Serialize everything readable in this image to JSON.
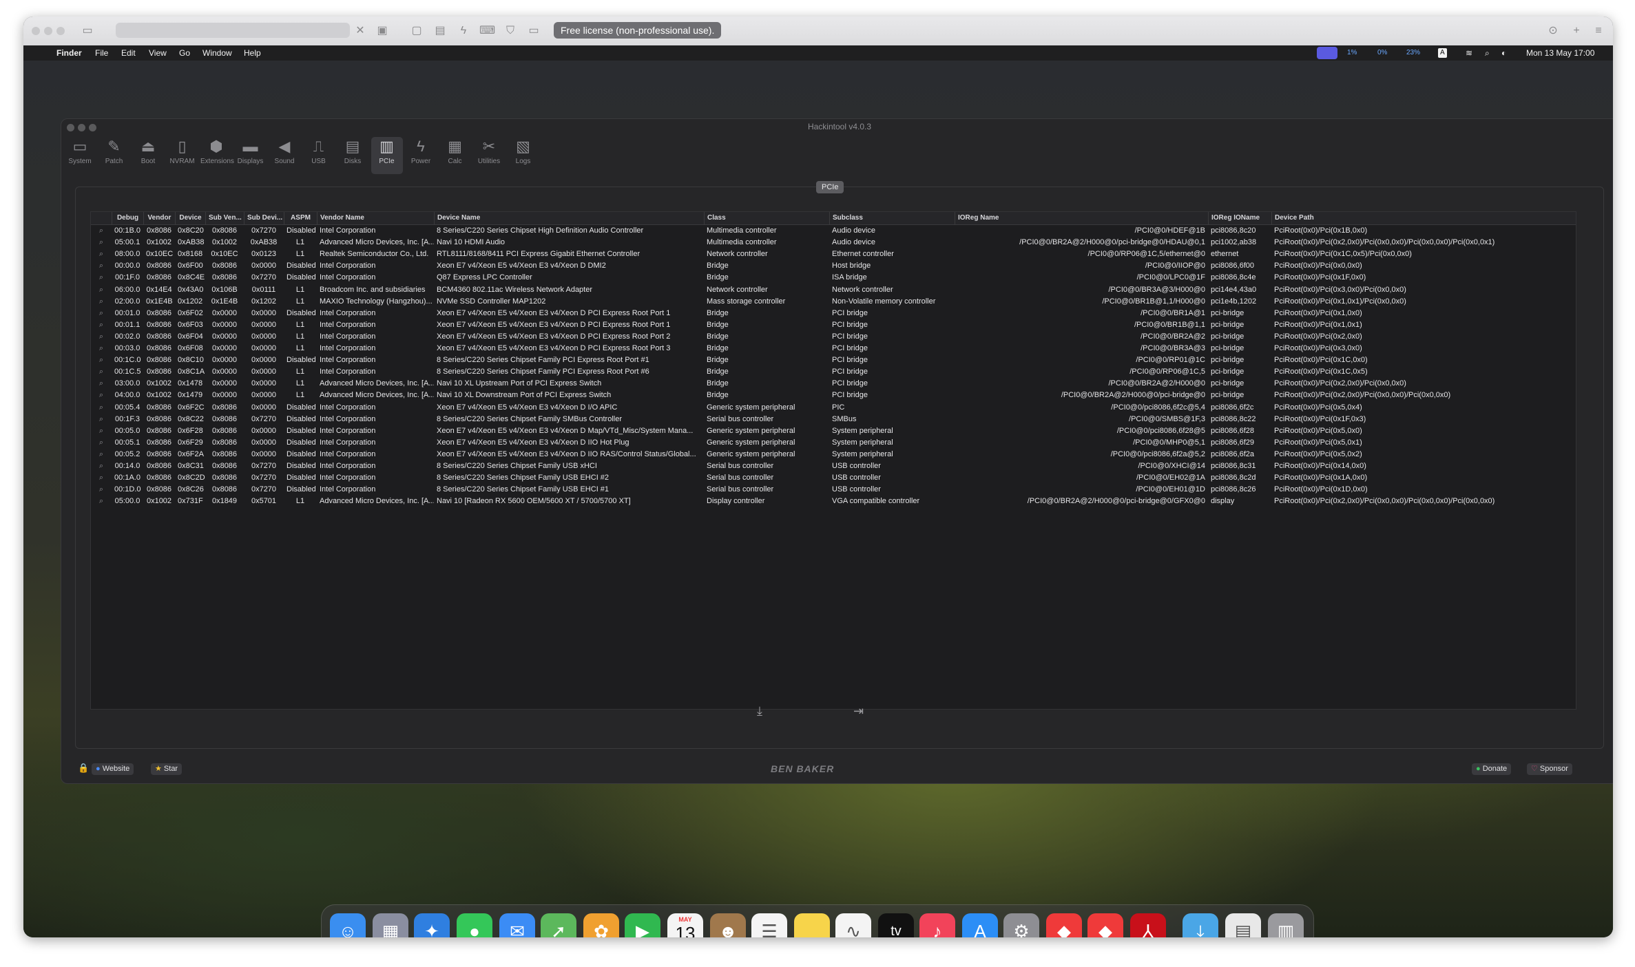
{
  "vm": {
    "license_badge": "Free license (non-professional use)."
  },
  "menubar": {
    "apple": "",
    "items": [
      "Finder",
      "File",
      "Edit",
      "View",
      "Go",
      "Window",
      "Help"
    ],
    "status": {
      "cpu": "1%",
      "gpu": "0%",
      "ram": "23%",
      "input": "A",
      "clock": "Mon 13 May  17:00"
    }
  },
  "window": {
    "title": "Hackintool v4.0.3",
    "toolbar": [
      {
        "label": "System",
        "icon": "system-icon"
      },
      {
        "label": "Patch",
        "icon": "patch-icon"
      },
      {
        "label": "Boot",
        "icon": "boot-icon"
      },
      {
        "label": "NVRAM",
        "icon": "nvram-icon"
      },
      {
        "label": "Extensions",
        "icon": "extensions-icon"
      },
      {
        "label": "Displays",
        "icon": "displays-icon"
      },
      {
        "label": "Sound",
        "icon": "sound-icon"
      },
      {
        "label": "USB",
        "icon": "usb-icon"
      },
      {
        "label": "Disks",
        "icon": "disks-icon"
      },
      {
        "label": "PCIe",
        "icon": "pcie-icon"
      },
      {
        "label": "Power",
        "icon": "power-icon"
      },
      {
        "label": "Calc",
        "icon": "calc-icon"
      },
      {
        "label": "Utilities",
        "icon": "utilities-icon"
      },
      {
        "label": "Logs",
        "icon": "logs-icon"
      }
    ],
    "active_tab": "PCIe",
    "pane_label": "PCIe",
    "columns": [
      "Debug",
      "Vendor",
      "Device",
      "Sub Ven...",
      "Sub Devi...",
      "ASPM",
      "Vendor Name",
      "Device Name",
      "Class",
      "Subclass",
      "IOReg Name",
      "IOReg IOName",
      "Device Path"
    ],
    "rows": [
      [
        "00:1B.0",
        "0x8086",
        "0x8C20",
        "0x8086",
        "0x7270",
        "Disabled",
        "Intel Corporation",
        "8 Series/C220 Series Chipset High Definition Audio Controller",
        "Multimedia controller",
        "Audio device",
        "/PCI0@0/HDEF@1B",
        "pci8086,8c20",
        "PciRoot(0x0)/Pci(0x1B,0x0)"
      ],
      [
        "05:00.1",
        "0x1002",
        "0xAB38",
        "0x1002",
        "0xAB38",
        "L1",
        "Advanced Micro Devices, Inc. [A...",
        "Navi 10 HDMI Audio",
        "Multimedia controller",
        "Audio device",
        "/PCI0@0/BR2A@2/H000@0/pci-bridge@0/HDAU@0,1",
        "pci1002,ab38",
        "PciRoot(0x0)/Pci(0x2,0x0)/Pci(0x0,0x0)/Pci(0x0,0x0)/Pci(0x0,0x1)"
      ],
      [
        "08:00.0",
        "0x10EC",
        "0x8168",
        "0x10EC",
        "0x0123",
        "L1",
        "Realtek Semiconductor Co., Ltd.",
        "RTL8111/8168/8411 PCI Express Gigabit Ethernet Controller",
        "Network controller",
        "Ethernet controller",
        "/PCI0@0/RP06@1C,5/ethernet@0",
        "ethernet",
        "PciRoot(0x0)/Pci(0x1C,0x5)/Pci(0x0,0x0)"
      ],
      [
        "00:00.0",
        "0x8086",
        "0x6F00",
        "0x8086",
        "0x0000",
        "Disabled",
        "Intel Corporation",
        "Xeon E7 v4/Xeon E5 v4/Xeon E3 v4/Xeon D DMI2",
        "Bridge",
        "Host bridge",
        "/PCI0@0/IIOP@0",
        "pci8086,6f00",
        "PciRoot(0x0)/Pci(0x0,0x0)"
      ],
      [
        "00:1F.0",
        "0x8086",
        "0x8C4E",
        "0x8086",
        "0x7270",
        "Disabled",
        "Intel Corporation",
        "Q87 Express LPC Controller",
        "Bridge",
        "ISA bridge",
        "/PCI0@0/LPC0@1F",
        "pci8086,8c4e",
        "PciRoot(0x0)/Pci(0x1F,0x0)"
      ],
      [
        "06:00.0",
        "0x14E4",
        "0x43A0",
        "0x106B",
        "0x0111",
        "L1",
        "Broadcom Inc. and subsidiaries",
        "BCM4360 802.11ac Wireless Network Adapter",
        "Network controller",
        "Network controller",
        "/PCI0@0/BR3A@3/H000@0",
        "pci14e4,43a0",
        "PciRoot(0x0)/Pci(0x3,0x0)/Pci(0x0,0x0)"
      ],
      [
        "02:00.0",
        "0x1E4B",
        "0x1202",
        "0x1E4B",
        "0x1202",
        "L1",
        "MAXIO Technology (Hangzhou)...",
        "NVMe SSD Controller MAP1202",
        "Mass storage controller",
        "Non-Volatile memory controller",
        "/PCI0@0/BR1B@1,1/H000@0",
        "pci1e4b,1202",
        "PciRoot(0x0)/Pci(0x1,0x1)/Pci(0x0,0x0)"
      ],
      [
        "00:01.0",
        "0x8086",
        "0x6F02",
        "0x0000",
        "0x0000",
        "Disabled",
        "Intel Corporation",
        "Xeon E7 v4/Xeon E5 v4/Xeon E3 v4/Xeon D PCI Express Root Port 1",
        "Bridge",
        "PCI bridge",
        "/PCI0@0/BR1A@1",
        "pci-bridge",
        "PciRoot(0x0)/Pci(0x1,0x0)"
      ],
      [
        "00:01.1",
        "0x8086",
        "0x6F03",
        "0x0000",
        "0x0000",
        "L1",
        "Intel Corporation",
        "Xeon E7 v4/Xeon E5 v4/Xeon E3 v4/Xeon D PCI Express Root Port 1",
        "Bridge",
        "PCI bridge",
        "/PCI0@0/BR1B@1,1",
        "pci-bridge",
        "PciRoot(0x0)/Pci(0x1,0x1)"
      ],
      [
        "00:02.0",
        "0x8086",
        "0x6F04",
        "0x0000",
        "0x0000",
        "L1",
        "Intel Corporation",
        "Xeon E7 v4/Xeon E5 v4/Xeon E3 v4/Xeon D PCI Express Root Port 2",
        "Bridge",
        "PCI bridge",
        "/PCI0@0/BR2A@2",
        "pci-bridge",
        "PciRoot(0x0)/Pci(0x2,0x0)"
      ],
      [
        "00:03.0",
        "0x8086",
        "0x6F08",
        "0x0000",
        "0x0000",
        "L1",
        "Intel Corporation",
        "Xeon E7 v4/Xeon E5 v4/Xeon E3 v4/Xeon D PCI Express Root Port 3",
        "Bridge",
        "PCI bridge",
        "/PCI0@0/BR3A@3",
        "pci-bridge",
        "PciRoot(0x0)/Pci(0x3,0x0)"
      ],
      [
        "00:1C.0",
        "0x8086",
        "0x8C10",
        "0x0000",
        "0x0000",
        "Disabled",
        "Intel Corporation",
        "8 Series/C220 Series Chipset Family PCI Express Root Port #1",
        "Bridge",
        "PCI bridge",
        "/PCI0@0/RP01@1C",
        "pci-bridge",
        "PciRoot(0x0)/Pci(0x1C,0x0)"
      ],
      [
        "00:1C.5",
        "0x8086",
        "0x8C1A",
        "0x0000",
        "0x0000",
        "L1",
        "Intel Corporation",
        "8 Series/C220 Series Chipset Family PCI Express Root Port #6",
        "Bridge",
        "PCI bridge",
        "/PCI0@0/RP06@1C,5",
        "pci-bridge",
        "PciRoot(0x0)/Pci(0x1C,0x5)"
      ],
      [
        "03:00.0",
        "0x1002",
        "0x1478",
        "0x0000",
        "0x0000",
        "L1",
        "Advanced Micro Devices, Inc. [A...",
        "Navi 10 XL Upstream Port of PCI Express Switch",
        "Bridge",
        "PCI bridge",
        "/PCI0@0/BR2A@2/H000@0",
        "pci-bridge",
        "PciRoot(0x0)/Pci(0x2,0x0)/Pci(0x0,0x0)"
      ],
      [
        "04:00.0",
        "0x1002",
        "0x1479",
        "0x0000",
        "0x0000",
        "L1",
        "Advanced Micro Devices, Inc. [A...",
        "Navi 10 XL Downstream Port of PCI Express Switch",
        "Bridge",
        "PCI bridge",
        "/PCI0@0/BR2A@2/H000@0/pci-bridge@0",
        "pci-bridge",
        "PciRoot(0x0)/Pci(0x2,0x0)/Pci(0x0,0x0)/Pci(0x0,0x0)"
      ],
      [
        "00:05.4",
        "0x8086",
        "0x6F2C",
        "0x8086",
        "0x0000",
        "Disabled",
        "Intel Corporation",
        "Xeon E7 v4/Xeon E5 v4/Xeon E3 v4/Xeon D I/O APIC",
        "Generic system peripheral",
        "PIC",
        "/PCI0@0/pci8086,6f2c@5,4",
        "pci8086,6f2c",
        "PciRoot(0x0)/Pci(0x5,0x4)"
      ],
      [
        "00:1F.3",
        "0x8086",
        "0x8C22",
        "0x8086",
        "0x7270",
        "Disabled",
        "Intel Corporation",
        "8 Series/C220 Series Chipset Family SMBus Controller",
        "Serial bus controller",
        "SMBus",
        "/PCI0@0/SMBS@1F,3",
        "pci8086,8c22",
        "PciRoot(0x0)/Pci(0x1F,0x3)"
      ],
      [
        "00:05.0",
        "0x8086",
        "0x6F28",
        "0x8086",
        "0x0000",
        "Disabled",
        "Intel Corporation",
        "Xeon E7 v4/Xeon E5 v4/Xeon E3 v4/Xeon D Map/VTd_Misc/System Mana...",
        "Generic system peripheral",
        "System peripheral",
        "/PCI0@0/pci8086,6f28@5",
        "pci8086,6f28",
        "PciRoot(0x0)/Pci(0x5,0x0)"
      ],
      [
        "00:05.1",
        "0x8086",
        "0x6F29",
        "0x8086",
        "0x0000",
        "Disabled",
        "Intel Corporation",
        "Xeon E7 v4/Xeon E5 v4/Xeon E3 v4/Xeon D IIO Hot Plug",
        "Generic system peripheral",
        "System peripheral",
        "/PCI0@0/MHP0@5,1",
        "pci8086,6f29",
        "PciRoot(0x0)/Pci(0x5,0x1)"
      ],
      [
        "00:05.2",
        "0x8086",
        "0x6F2A",
        "0x8086",
        "0x0000",
        "Disabled",
        "Intel Corporation",
        "Xeon E7 v4/Xeon E5 v4/Xeon E3 v4/Xeon D IIO RAS/Control Status/Global...",
        "Generic system peripheral",
        "System peripheral",
        "/PCI0@0/pci8086,6f2a@5,2",
        "pci8086,6f2a",
        "PciRoot(0x0)/Pci(0x5,0x2)"
      ],
      [
        "00:14.0",
        "0x8086",
        "0x8C31",
        "0x8086",
        "0x7270",
        "Disabled",
        "Intel Corporation",
        "8 Series/C220 Series Chipset Family USB xHCI",
        "Serial bus controller",
        "USB controller",
        "/PCI0@0/XHCI@14",
        "pci8086,8c31",
        "PciRoot(0x0)/Pci(0x14,0x0)"
      ],
      [
        "00:1A.0",
        "0x8086",
        "0x8C2D",
        "0x8086",
        "0x7270",
        "Disabled",
        "Intel Corporation",
        "8 Series/C220 Series Chipset Family USB EHCI #2",
        "Serial bus controller",
        "USB controller",
        "/PCI0@0/EH02@1A",
        "pci8086,8c2d",
        "PciRoot(0x0)/Pci(0x1A,0x0)"
      ],
      [
        "00:1D.0",
        "0x8086",
        "0x8C26",
        "0x8086",
        "0x7270",
        "Disabled",
        "Intel Corporation",
        "8 Series/C220 Series Chipset Family USB EHCI #1",
        "Serial bus controller",
        "USB controller",
        "/PCI0@0/EH01@1D",
        "pci8086,8c26",
        "PciRoot(0x0)/Pci(0x1D,0x0)"
      ],
      [
        "05:00.0",
        "0x1002",
        "0x731F",
        "0x1849",
        "0x5701",
        "L1",
        "Advanced Micro Devices, Inc. [A...",
        "Navi 10 [Radeon RX 5600 OEM/5600 XT / 5700/5700 XT]",
        "Display controller",
        "VGA compatible controller",
        "/PCI0@0/BR2A@2/H000@0/pci-bridge@0/GFX0@0",
        "display",
        "PciRoot(0x0)/Pci(0x2,0x0)/Pci(0x0,0x0)/Pci(0x0,0x0)/Pci(0x0,0x0)"
      ]
    ],
    "footer": {
      "website": "Website",
      "star": "Star",
      "brand": "BEN BAKER",
      "donate": "Donate",
      "sponsor": "Sponsor"
    }
  },
  "dock": {
    "apps": [
      "finder-icon",
      "launchpad-icon",
      "safari-icon",
      "messages-icon",
      "mail-icon",
      "maps-icon",
      "photos-icon",
      "facetime-icon",
      "calendar-icon",
      "contacts-icon",
      "reminders-icon",
      "notes-icon",
      "freeform-icon",
      "tv-icon",
      "music-icon",
      "app-store-icon",
      "system-settings-icon",
      "anydesk-icon",
      "anydesk-alt-icon",
      "acrobat-icon",
      "downloads-folder-icon",
      "document-stack-icon",
      "trash-icon"
    ],
    "calendar_month": "MAY",
    "calendar_day": "13",
    "tv_label": "tv"
  }
}
